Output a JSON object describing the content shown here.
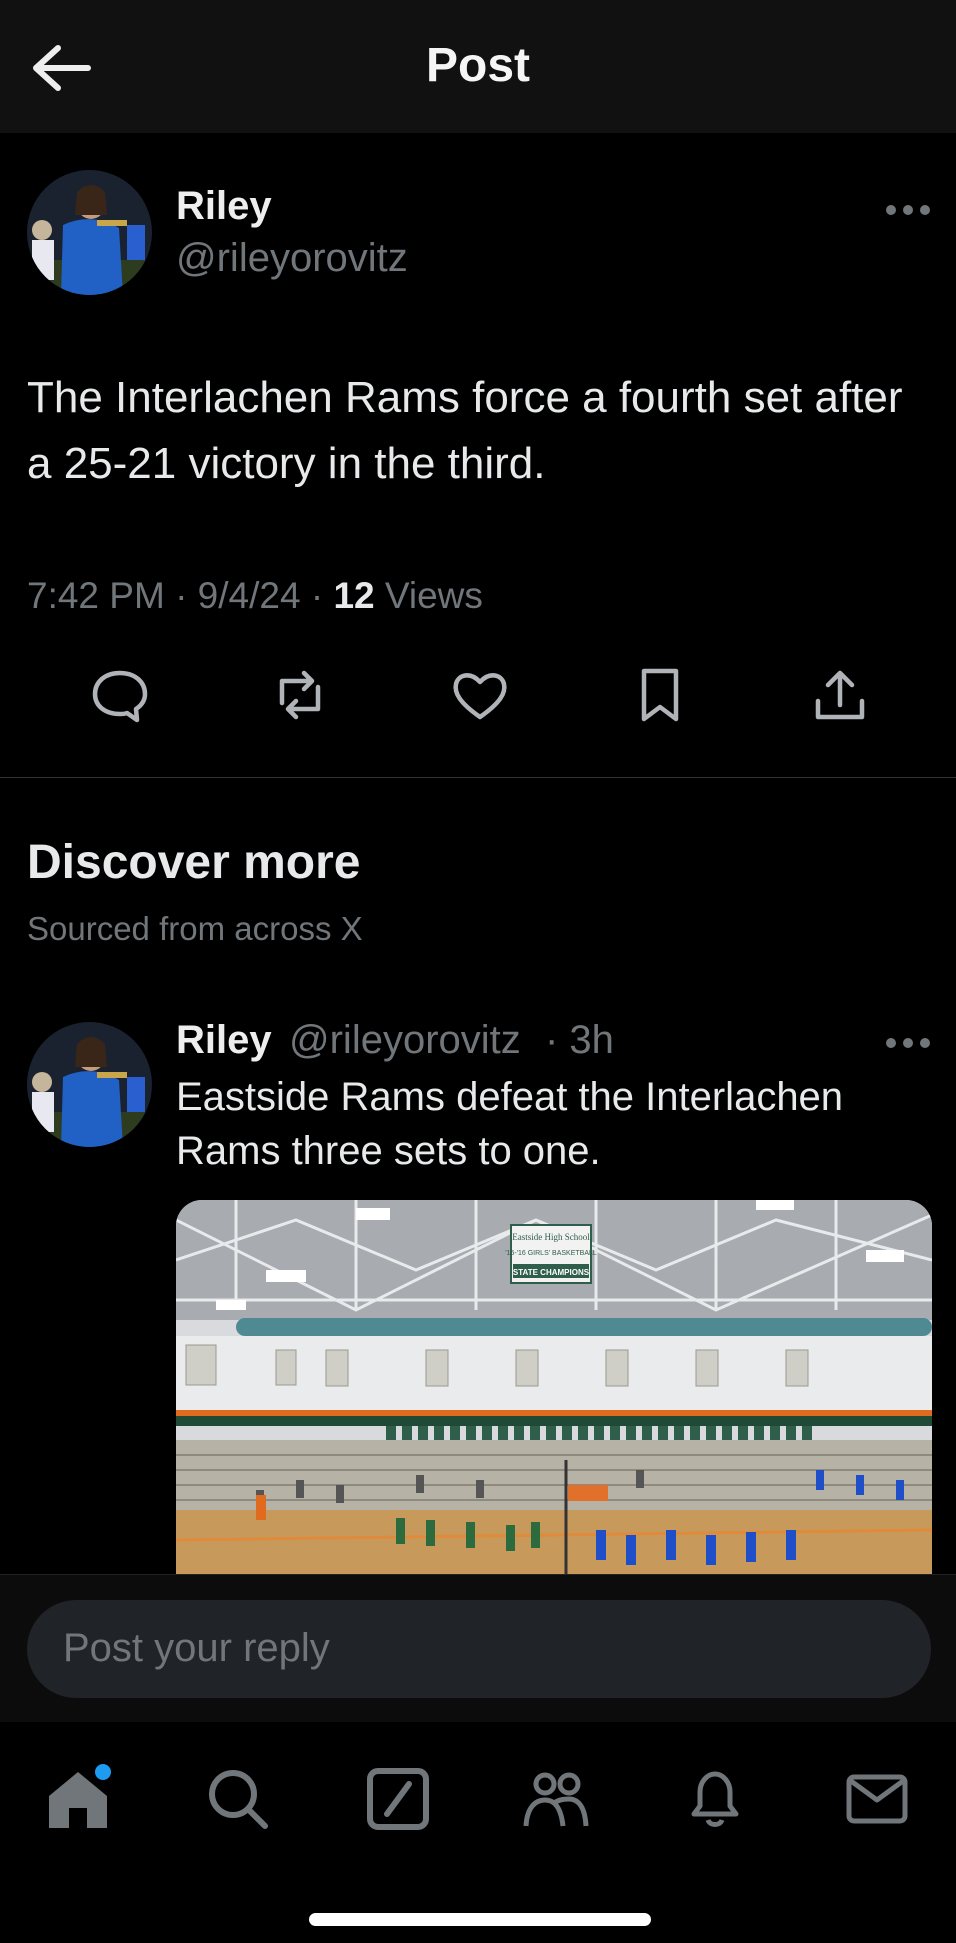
{
  "header": {
    "title": "Post"
  },
  "post": {
    "name": "Riley",
    "handle": "@rileyorovitz",
    "text": "The Interlachen Rams force a fourth set after a 25-21 victory in the third.",
    "time": "7:42 PM · 9/4/24 · ",
    "views_count": "12",
    "views_label": " Views"
  },
  "discover": {
    "title": "Discover more",
    "subtitle": "Sourced from across X"
  },
  "related": {
    "name": "Riley",
    "handle": "@rileyorovitz",
    "age": "· 3h",
    "text": "Eastside Rams defeat the Interlachen Rams three sets to one.",
    "banner_line1": "Eastside High School",
    "banner_line2": "'15-'16 GIRLS' BASKETBALL",
    "banner_line3": "STATE CHAMPIONS"
  },
  "reply": {
    "placeholder": "Post your reply"
  },
  "colors": {
    "background": "#000000",
    "muted": "#71767b",
    "accent": "#1d9bf0"
  },
  "icons": {
    "actions": [
      "reply-icon",
      "repost-icon",
      "like-icon",
      "bookmark-icon",
      "share-icon"
    ],
    "nav": [
      "home-icon",
      "search-icon",
      "grok-icon",
      "communities-icon",
      "notifications-icon",
      "messages-icon"
    ]
  }
}
